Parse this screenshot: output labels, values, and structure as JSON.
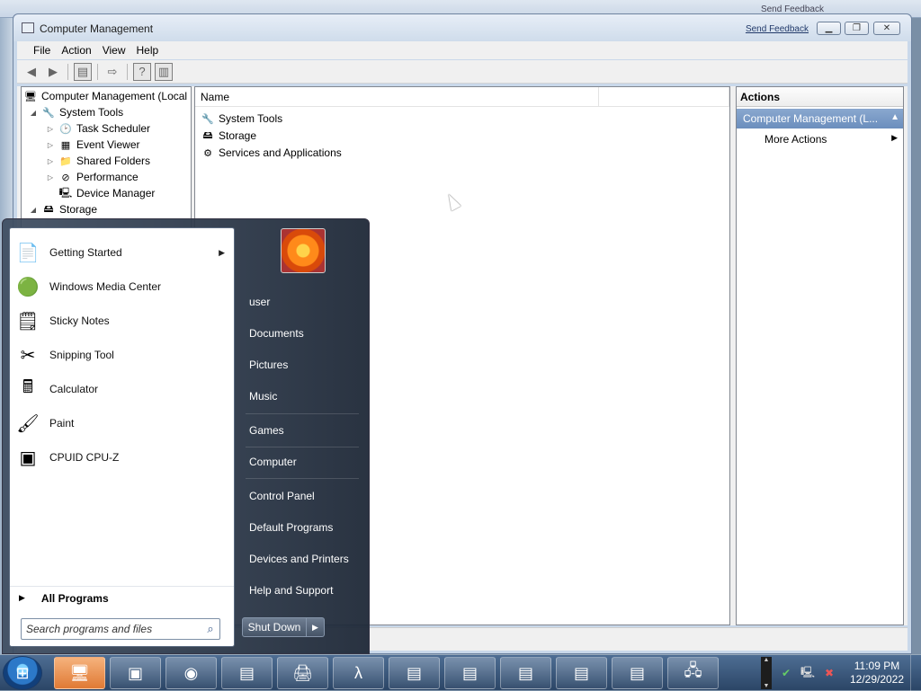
{
  "background": {
    "feedback_label": "Send Feedback"
  },
  "window": {
    "title": "Computer Management",
    "send_feedback": "Send Feedback",
    "menu": [
      "File",
      "Action",
      "View",
      "Help"
    ]
  },
  "tree": [
    {
      "label": "Computer Management (Local",
      "level": 0,
      "expander": "",
      "icon": "computer-management-icon"
    },
    {
      "label": "System Tools",
      "level": 1,
      "expander": "expanded",
      "icon": "system-tools-icon"
    },
    {
      "label": "Task Scheduler",
      "level": 2,
      "expander": "collapsed",
      "icon": "task-scheduler-icon"
    },
    {
      "label": "Event Viewer",
      "level": 2,
      "expander": "collapsed",
      "icon": "event-viewer-icon"
    },
    {
      "label": "Shared Folders",
      "level": 2,
      "expander": "collapsed",
      "icon": "shared-folders-icon"
    },
    {
      "label": "Performance",
      "level": 2,
      "expander": "collapsed",
      "icon": "performance-icon"
    },
    {
      "label": "Device Manager",
      "level": 2,
      "expander": "",
      "icon": "device-manager-icon"
    },
    {
      "label": "Storage",
      "level": 1,
      "expander": "expanded",
      "icon": "storage-icon"
    }
  ],
  "list": {
    "columns": [
      "Name"
    ],
    "items": [
      "System Tools",
      "Storage",
      "Services and Applications"
    ]
  },
  "actions": {
    "title": "Actions",
    "group": "Computer Management (L...",
    "items": [
      "More Actions"
    ]
  },
  "start_menu": {
    "programs": [
      {
        "label": "Getting Started",
        "icon": "getting-started-icon",
        "has_submenu": true
      },
      {
        "label": "Windows Media Center",
        "icon": "windows-media-center-icon",
        "has_submenu": false
      },
      {
        "label": "Sticky Notes",
        "icon": "sticky-notes-icon",
        "has_submenu": false
      },
      {
        "label": "Snipping Tool",
        "icon": "snipping-tool-icon",
        "has_submenu": false
      },
      {
        "label": "Calculator",
        "icon": "calculator-icon",
        "has_submenu": false
      },
      {
        "label": "Paint",
        "icon": "paint-icon",
        "has_submenu": false
      },
      {
        "label": "CPUID CPU-Z",
        "icon": "cpu-z-icon",
        "has_submenu": false
      }
    ],
    "all_programs": "All Programs",
    "search_placeholder": "Search programs and files",
    "right_items": [
      "user",
      "Documents",
      "Pictures",
      "Music",
      "Games",
      "Computer",
      "Control Panel",
      "Default Programs",
      "Devices and Printers",
      "Help and Support"
    ],
    "shutdown": "Shut Down"
  },
  "taskbar": {
    "apps": [
      "computer-management-icon",
      "display-icon",
      "media-player-icon",
      "window-icon",
      "scanner-icon",
      "terminal-icon",
      "window-icon",
      "window-icon",
      "window-icon",
      "window-icon",
      "window-icon",
      "network-icon"
    ],
    "time": "11:09 PM",
    "date": "12/29/2022"
  }
}
